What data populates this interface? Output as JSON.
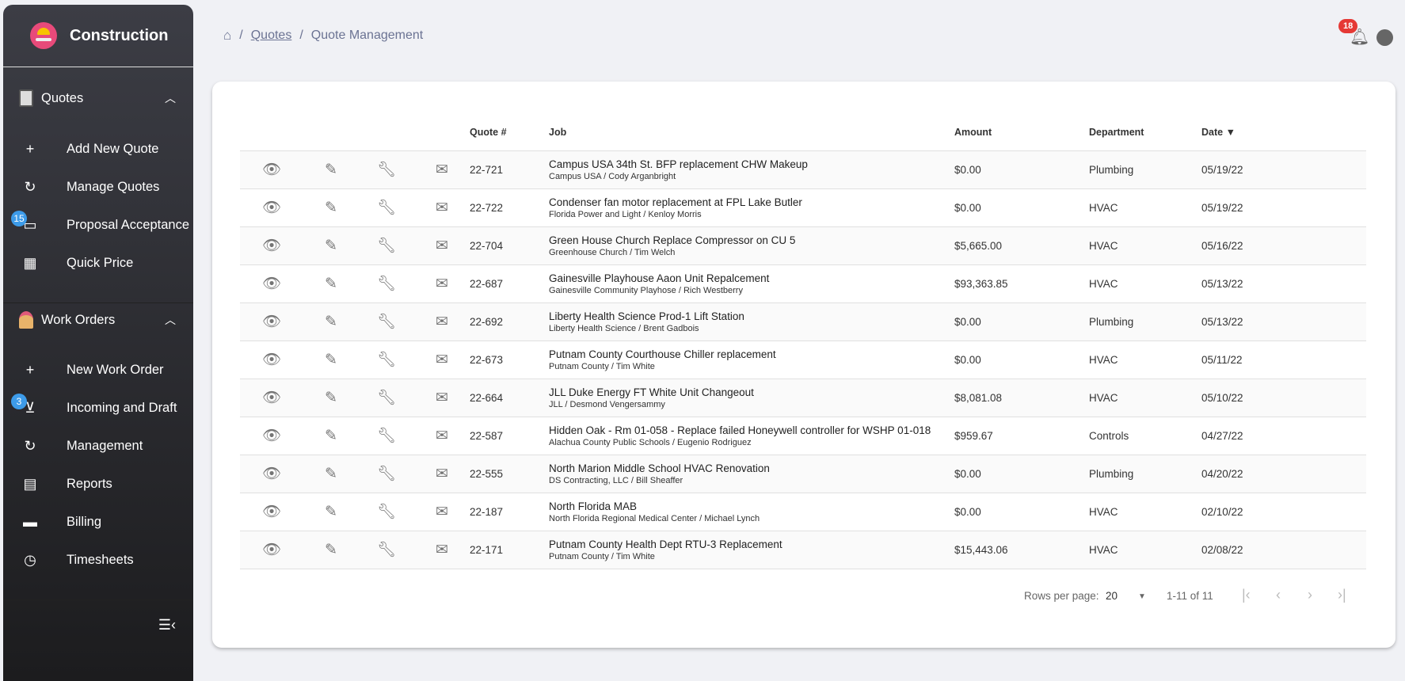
{
  "app": {
    "title": "Construction"
  },
  "sidebar": {
    "quotes": {
      "label": "Quotes",
      "items": [
        {
          "label": "Add New Quote",
          "icon": "plus-icon"
        },
        {
          "label": "Manage Quotes",
          "icon": "history-icon"
        },
        {
          "label": "Proposal Acceptance",
          "icon": "card-check-icon",
          "badge": "15"
        },
        {
          "label": "Quick Price",
          "icon": "calculator-icon"
        }
      ]
    },
    "work_orders": {
      "label": "Work Orders",
      "items": [
        {
          "label": "New Work Order",
          "icon": "plus-icon"
        },
        {
          "label": "Incoming and Draft",
          "icon": "inbox-icon",
          "badge": "3"
        },
        {
          "label": "Management",
          "icon": "history-icon"
        },
        {
          "label": "Reports",
          "icon": "report-icon"
        },
        {
          "label": "Billing",
          "icon": "cash-register-icon"
        },
        {
          "label": "Timesheets",
          "icon": "clock-icon"
        }
      ]
    }
  },
  "breadcrumb": {
    "link": "Quotes",
    "current": "Quote Management"
  },
  "header": {
    "notifications": "18"
  },
  "table": {
    "columns": {
      "quote": "Quote #",
      "job": "Job",
      "amount": "Amount",
      "department": "Department",
      "date": "Date ▼"
    },
    "rows": [
      {
        "quote": "22-721",
        "job": "Campus USA 34th St. BFP replacement CHW Makeup",
        "client": "Campus USA / Cody Arganbright",
        "amount": "$0.00",
        "department": "Plumbing",
        "date": "05/19/22"
      },
      {
        "quote": "22-722",
        "job": "Condenser fan motor replacement at FPL Lake Butler",
        "client": "Florida Power and Light / Kenloy Morris",
        "amount": "$0.00",
        "department": "HVAC",
        "date": "05/19/22"
      },
      {
        "quote": "22-704",
        "job": "Green House Church Replace Compressor on CU 5",
        "client": "Greenhouse Church / Tim Welch",
        "amount": "$5,665.00",
        "department": "HVAC",
        "date": "05/16/22"
      },
      {
        "quote": "22-687",
        "job": "Gainesville Playhouse Aaon Unit Repalcement",
        "client": "Gainesville Community Playhose / Rich Westberry",
        "amount": "$93,363.85",
        "department": "HVAC",
        "date": "05/13/22"
      },
      {
        "quote": "22-692",
        "job": "Liberty Health Science Prod-1 Lift Station",
        "client": "Liberty Health Science / Brent Gadbois",
        "amount": "$0.00",
        "department": "Plumbing",
        "date": "05/13/22"
      },
      {
        "quote": "22-673",
        "job": "Putnam County Courthouse Chiller replacement",
        "client": "Putnam County / Tim White",
        "amount": "$0.00",
        "department": "HVAC",
        "date": "05/11/22"
      },
      {
        "quote": "22-664",
        "job": "JLL Duke Energy FT White Unit Changeout",
        "client": "JLL / Desmond Vengersammy",
        "amount": "$8,081.08",
        "department": "HVAC",
        "date": "05/10/22"
      },
      {
        "quote": "22-587",
        "job": "Hidden Oak - Rm 01-058 - Replace failed Honeywell controller for WSHP 01-018",
        "client": "Alachua County Public Schools / Eugenio Rodriguez",
        "amount": "$959.67",
        "department": "Controls",
        "date": "04/27/22"
      },
      {
        "quote": "22-555",
        "job": "North Marion Middle School HVAC Renovation",
        "client": "DS Contracting, LLC / Bill Sheaffer",
        "amount": "$0.00",
        "department": "Plumbing",
        "date": "04/20/22"
      },
      {
        "quote": "22-187",
        "job": "North Florida MAB",
        "client": "North Florida Regional Medical Center / Michael Lynch",
        "amount": "$0.00",
        "department": "HVAC",
        "date": "02/10/22"
      },
      {
        "quote": "22-171",
        "job": "Putnam County Health Dept RTU-3 Replacement",
        "client": "Putnam County / Tim White",
        "amount": "$15,443.06",
        "department": "HVAC",
        "date": "02/08/22"
      }
    ]
  },
  "pagination": {
    "rows_label": "Rows per page:",
    "rows_value": "20",
    "range": "1-11 of 11"
  }
}
